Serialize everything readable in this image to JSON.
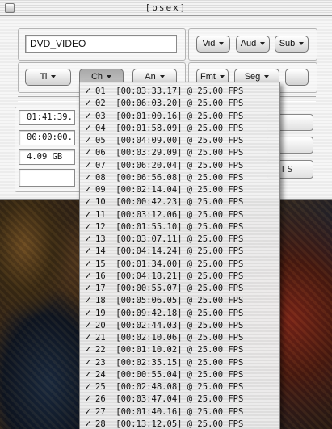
{
  "window": {
    "title": "[osex]"
  },
  "source_field": {
    "value": "DVD_VIDEO"
  },
  "buttons": {
    "vid": "Vid",
    "aud": "Aud",
    "sub": "Sub",
    "ti": "Ti",
    "ch": "Ch",
    "an": "An",
    "fmt": "Fmt",
    "seg": "Seg"
  },
  "info": {
    "duration": "01:41:39.",
    "position": "00:00:00.",
    "size": "4.09 GB"
  },
  "partial_label": "TS",
  "chapter_menu": {
    "items": [
      {
        "check": "✓",
        "label": "01  [00:03:33.17] @ 25.00 FPS"
      },
      {
        "check": "✓",
        "label": "02  [00:06:03.20] @ 25.00 FPS"
      },
      {
        "check": "✓",
        "label": "03  [00:01:00.16] @ 25.00 FPS"
      },
      {
        "check": "✓",
        "label": "04  [00:01:58.09] @ 25.00 FPS"
      },
      {
        "check": "✓",
        "label": "05  [00:04:09.00] @ 25.00 FPS"
      },
      {
        "check": "✓",
        "label": "06  [00:03:29.09] @ 25.00 FPS"
      },
      {
        "check": "✓",
        "label": "07  [00:06:20.04] @ 25.00 FPS"
      },
      {
        "check": "✓",
        "label": "08  [00:06:56.08] @ 25.00 FPS"
      },
      {
        "check": "✓",
        "label": "09  [00:02:14.04] @ 25.00 FPS"
      },
      {
        "check": "✓",
        "label": "10  [00:00:42.23] @ 25.00 FPS"
      },
      {
        "check": "✓",
        "label": "11  [00:03:12.06] @ 25.00 FPS"
      },
      {
        "check": "✓",
        "label": "12  [00:01:55.10] @ 25.00 FPS"
      },
      {
        "check": "✓",
        "label": "13  [00:03:07.11] @ 25.00 FPS"
      },
      {
        "check": "✓",
        "label": "14  [00:04:14.24] @ 25.00 FPS"
      },
      {
        "check": "✓",
        "label": "15  [00:01:34.00] @ 25.00 FPS"
      },
      {
        "check": "✓",
        "label": "16  [00:04:18.21] @ 25.00 FPS"
      },
      {
        "check": "✓",
        "label": "17  [00:00:55.07] @ 25.00 FPS"
      },
      {
        "check": "✓",
        "label": "18  [00:05:06.05] @ 25.00 FPS"
      },
      {
        "check": "✓",
        "label": "19  [00:09:42.18] @ 25.00 FPS"
      },
      {
        "check": "✓",
        "label": "20  [00:02:44.03] @ 25.00 FPS"
      },
      {
        "check": "✓",
        "label": "21  [00:02:10.06] @ 25.00 FPS"
      },
      {
        "check": "✓",
        "label": "22  [00:01:10.02] @ 25.00 FPS"
      },
      {
        "check": "✓",
        "label": "23  [00:02:35.15] @ 25.00 FPS"
      },
      {
        "check": "✓",
        "label": "24  [00:00:55.04] @ 25.00 FPS"
      },
      {
        "check": "✓",
        "label": "25  [00:02:48.08] @ 25.00 FPS"
      },
      {
        "check": "✓",
        "label": "26  [00:03:47.04] @ 25.00 FPS"
      },
      {
        "check": "✓",
        "label": "27  [00:01:40.16] @ 25.00 FPS"
      },
      {
        "check": "✓",
        "label": "28  [00:13:12.05] @ 25.00 FPS"
      }
    ]
  }
}
